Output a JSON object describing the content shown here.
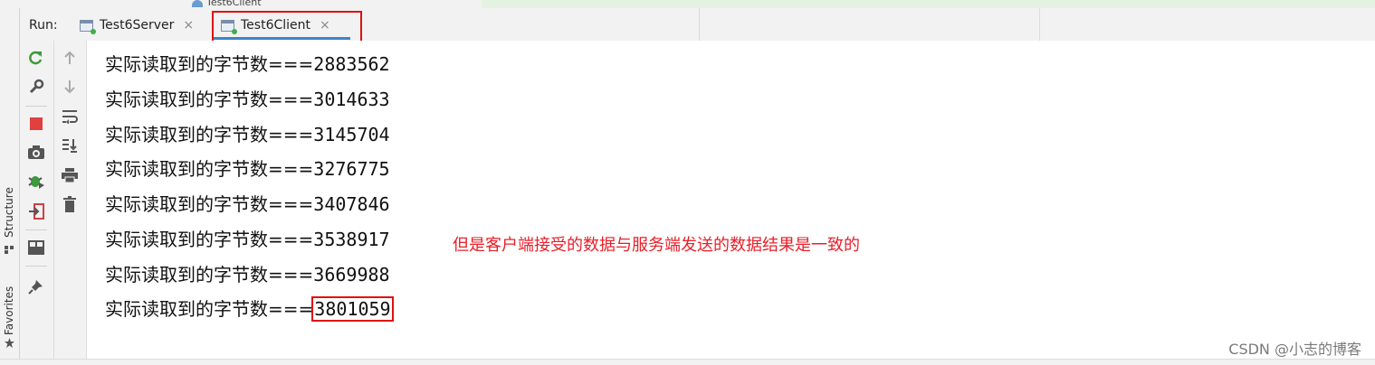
{
  "window": {
    "top_tab_ghost": "Test6Client"
  },
  "run_bar": {
    "label": "Run:",
    "tabs": [
      {
        "label": "Test6Server",
        "close": "×"
      },
      {
        "label": "Test6Client",
        "close": "×"
      }
    ],
    "active_tab_index": 1
  },
  "side_tool_windows": {
    "structure": "Structure",
    "favorites": "Favorites"
  },
  "toolbar_left": [
    "rerun-icon",
    "wrench-icon",
    "stop-icon",
    "camera-icon",
    "debug-icon",
    "login-icon",
    "layout-icon",
    "pin-icon"
  ],
  "toolbar_right": [
    "arrow-up-icon",
    "arrow-down-icon",
    "soft-wrap-icon",
    "scroll-to-end-icon",
    "print-icon",
    "trash-icon"
  ],
  "console": {
    "lines": [
      {
        "label": "实际读取到的字节数===",
        "value": "2883562"
      },
      {
        "label": "实际读取到的字节数===",
        "value": "3014633"
      },
      {
        "label": "实际读取到的字节数===",
        "value": "3145704"
      },
      {
        "label": "实际读取到的字节数===",
        "value": "3276775"
      },
      {
        "label": "实际读取到的字节数===",
        "value": "3407846"
      },
      {
        "label": "实际读取到的字节数===",
        "value": "3538917"
      },
      {
        "label": "实际读取到的字节数===",
        "value": "3669988"
      },
      {
        "label": "实际读取到的字节数===",
        "value": "3801059"
      }
    ]
  },
  "annotation": "但是客户端接受的数据与服务端发送的数据结果是一致的",
  "watermark": "CSDN @小志的博客",
  "colors": {
    "annotation_red": "#e8202a",
    "highlight_box": "#e01010",
    "active_tab_underline": "#4083c9"
  }
}
